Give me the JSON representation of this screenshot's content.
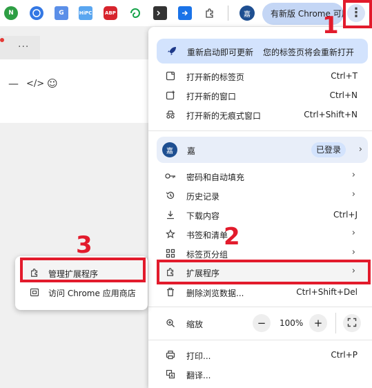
{
  "toolbar": {
    "extensions": [
      {
        "icon": "green-n-extension-icon",
        "text": "N",
        "color": "#2e9e44"
      },
      {
        "icon": "blue-globe-extension-icon",
        "text": "",
        "color": "#3478e4"
      },
      {
        "icon": "translate-extension-icon",
        "text": "G",
        "color": "#5b8fe8"
      },
      {
        "icon": "hipc-extension-icon",
        "text": "HiPC",
        "color": "#5aa6f0"
      },
      {
        "icon": "abp-extension-icon",
        "text": "ABP",
        "color": "#d7242d"
      },
      {
        "icon": "green-swirl-extension-icon",
        "text": "",
        "color": "#16a34a"
      },
      {
        "icon": "terminal-extension-icon",
        "text": "",
        "color": "#333333"
      },
      {
        "icon": "share-extension-icon",
        "text": "",
        "color": "#1a73e8"
      },
      {
        "icon": "puzzle-extensions-icon",
        "text": "",
        "color": "#444444"
      }
    ],
    "profile_initial": "嘉",
    "update_label": "有新版 Chrome 可用",
    "menu_icon": "three-dot-menu-icon"
  },
  "menu": {
    "banner": {
      "title": "重新启动即可更新",
      "desc": "您的标签页将会重新打开"
    },
    "new_tab": {
      "label": "打开新的标签页",
      "shortcut": "Ctrl+T"
    },
    "new_window": {
      "label": "打开新的窗口",
      "shortcut": "Ctrl+N"
    },
    "incognito": {
      "label": "打开新的无痕式窗口",
      "shortcut": "Ctrl+Shift+N"
    },
    "profile": {
      "name": "嘉",
      "status": "已登录"
    },
    "passwords": {
      "label": "密码和自动填充"
    },
    "history": {
      "label": "历史记录"
    },
    "downloads": {
      "label": "下载内容",
      "shortcut": "Ctrl+J"
    },
    "bookmarks": {
      "label": "书签和清单"
    },
    "tab_groups": {
      "label": "标签页分组"
    },
    "extensions": {
      "label": "扩展程序"
    },
    "clear_data": {
      "label": "删除浏览数据...",
      "shortcut": "Ctrl+Shift+Del"
    },
    "zoom": {
      "label": "缩放",
      "minus": "−",
      "value": "100%",
      "plus": "+"
    },
    "print": {
      "label": "打印...",
      "shortcut": "Ctrl+P"
    },
    "translate": {
      "label": "翻译..."
    }
  },
  "submenu": {
    "manage": {
      "label": "管理扩展程序"
    },
    "store": {
      "label": "访问 Chrome 应用商店"
    }
  },
  "annotations": {
    "step1": "1",
    "step2": "2",
    "step3": "3",
    "color": "#e21b2c"
  }
}
